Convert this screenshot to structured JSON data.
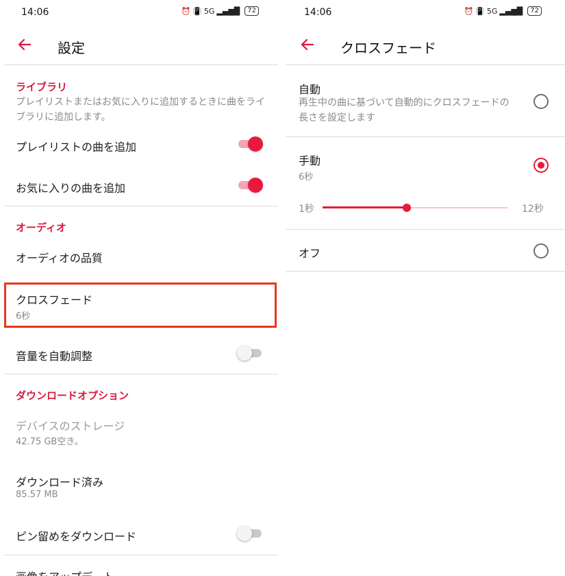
{
  "colors": {
    "accent": "#e8193c",
    "highlight_box": "#e8361e"
  },
  "status": {
    "time": "14:06",
    "network": "5G",
    "battery": "72"
  },
  "left": {
    "title": "設定",
    "sections": {
      "library": {
        "header": "ライブラリ",
        "description": "プレイリストまたはお気に入りに追加するときに曲をライブラリに追加します。",
        "add_playlist_songs": {
          "label": "プレイリストの曲を追加",
          "on": true
        },
        "add_favorite_songs": {
          "label": "お気に入りの曲を追加",
          "on": true
        }
      },
      "audio": {
        "header": "オーディオ",
        "quality_label": "オーディオの品質",
        "crossfade_label": "クロスフェード",
        "crossfade_value": "6秒",
        "auto_volume": {
          "label": "音量を自動調整",
          "on": false
        }
      },
      "download": {
        "header": "ダウンロードオプション",
        "storage_label": "デバイスのストレージ",
        "storage_value": "42.75 GB空き。",
        "downloaded_label": "ダウンロード済み",
        "downloaded_value": "85.57 MB",
        "download_pins": {
          "label": "ピン留めをダウンロード",
          "on": false
        },
        "update_images_label": "画像をアップデート"
      }
    }
  },
  "right": {
    "title": "クロスフェード",
    "options": {
      "auto": {
        "label": "自動",
        "description": "再生中の曲に基づいて自動的にクロスフェードの長さを設定します",
        "selected": false
      },
      "manual": {
        "label": "手動",
        "value": "6秒",
        "selected": true
      },
      "off": {
        "label": "オフ",
        "selected": false
      }
    },
    "slider": {
      "min_label": "1秒",
      "max_label": "12秒",
      "min": 1,
      "max": 12,
      "value": 6
    }
  }
}
